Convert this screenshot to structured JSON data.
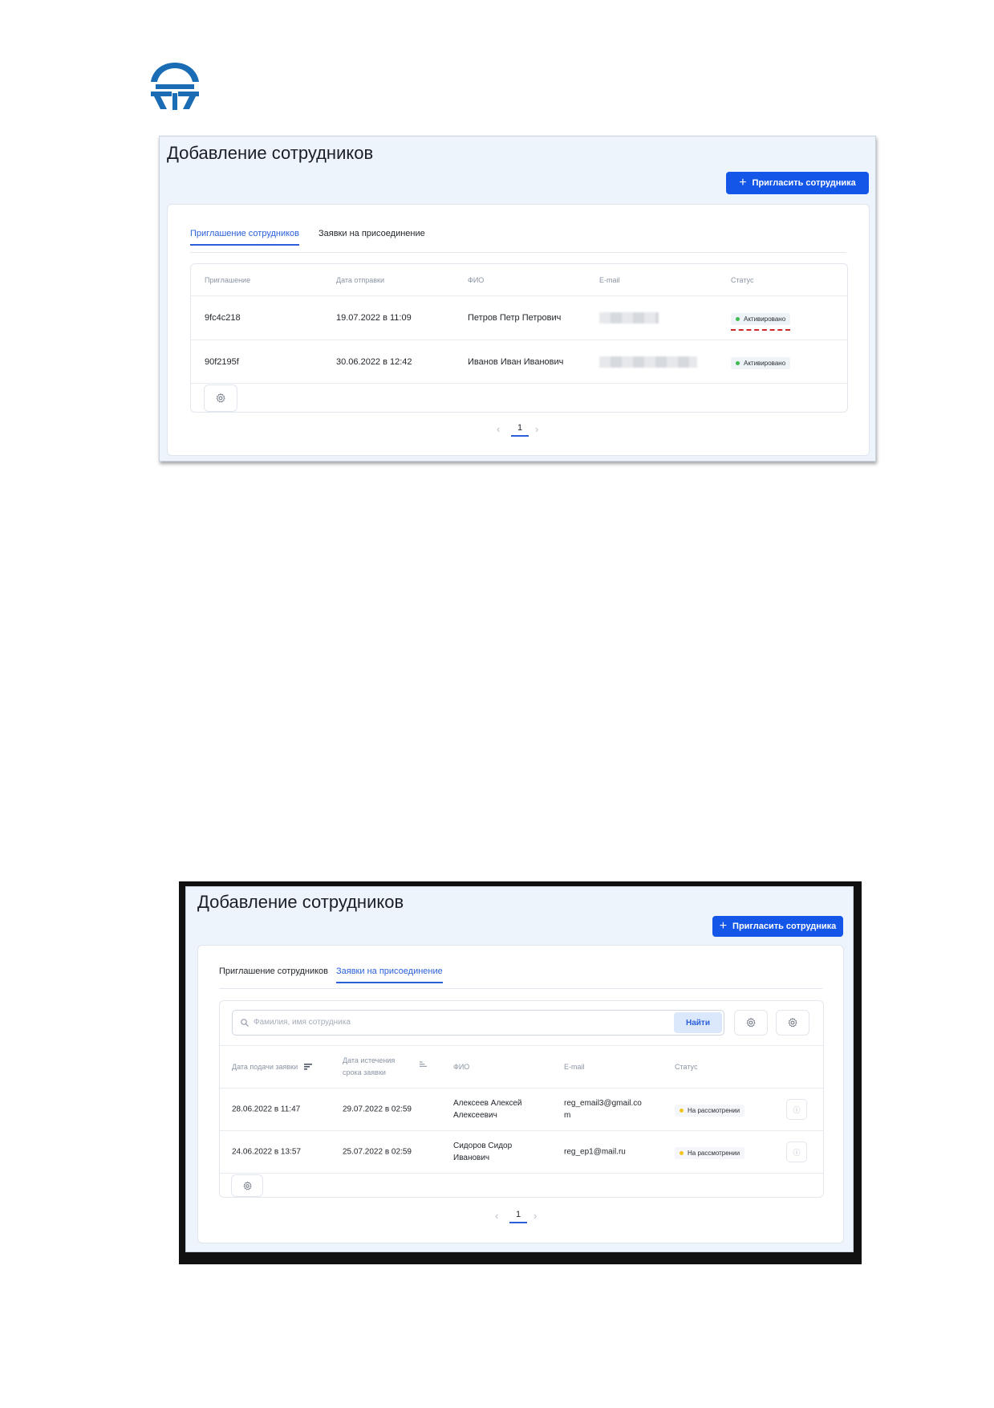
{
  "colors": {
    "accent": "#1356e8",
    "tab_active": "#2b5fd9",
    "status_green": "#3fb950",
    "status_yellow": "#f2c41b",
    "logo": "#1a6db5"
  },
  "logo": {
    "icon": "company-logo"
  },
  "screen1": {
    "title": "Добавление сотрудников",
    "invite_button": "Пригласить сотрудника",
    "tabs": [
      "Приглашение сотрудников",
      "Заявки на присоединение"
    ],
    "active_tab": 0,
    "columns": [
      "Приглашение",
      "Дата отправки",
      "ФИО",
      "E-mail",
      "Статус"
    ],
    "rows": [
      {
        "code": "9fc4c218",
        "date": "19.07.2022 в 11:09",
        "name": "Петров Петр Петрович",
        "email": "",
        "status": "Активировано"
      },
      {
        "code": "90f2195f",
        "date": "30.06.2022 в 12:42",
        "name": "Иванов Иван Иванович",
        "email": "",
        "status": "Активировано"
      }
    ],
    "page": "1"
  },
  "screen2": {
    "title": "Добавление сотрудников",
    "invite_button": "Пригласить сотрудника",
    "tabs": [
      "Приглашение сотрудников",
      "Заявки на присоединение"
    ],
    "active_tab": 1,
    "search_placeholder": "Фамилия, имя сотрудника",
    "search_button": "Найти",
    "columns": [
      "Дата подачи заявки",
      "Дата истечения срока заявки",
      "ФИО",
      "E-mail",
      "Статус"
    ],
    "rows": [
      {
        "submitted": "28.06.2022 в 11:47",
        "expires": "29.07.2022 в 02:59",
        "name": "Алексеев Алексей Алексеевич",
        "email": "reg_email3@gmail.com",
        "status": "На рассмотрении"
      },
      {
        "submitted": "24.06.2022 в 13:57",
        "expires": "25.07.2022 в 02:59",
        "name": "Сидоров Сидор Иванович",
        "email": "reg_ep1@mail.ru",
        "status": "На рассмотрении"
      }
    ],
    "page": "1"
  }
}
